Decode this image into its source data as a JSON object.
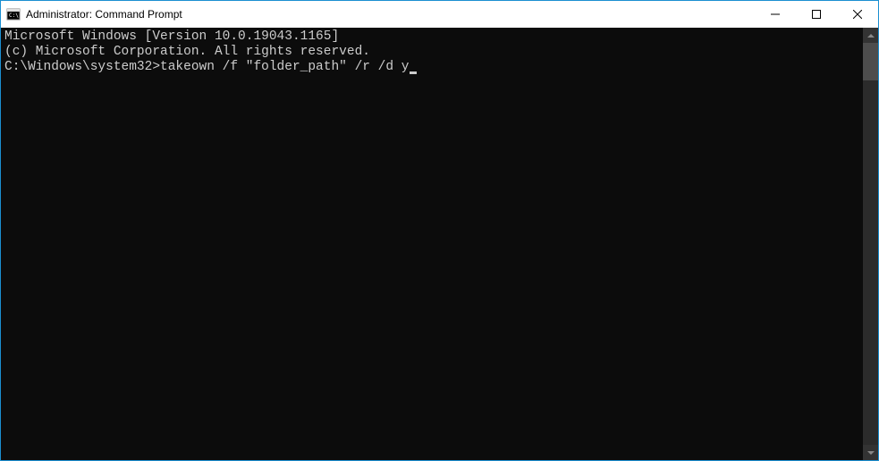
{
  "window": {
    "title": "Administrator: Command Prompt"
  },
  "console": {
    "line1": "Microsoft Windows [Version 10.0.19043.1165]",
    "line2": "(c) Microsoft Corporation. All rights reserved.",
    "blank": "",
    "prompt": "C:\\Windows\\system32>",
    "command": "takeown /f \"folder_path\" /r /d y"
  }
}
